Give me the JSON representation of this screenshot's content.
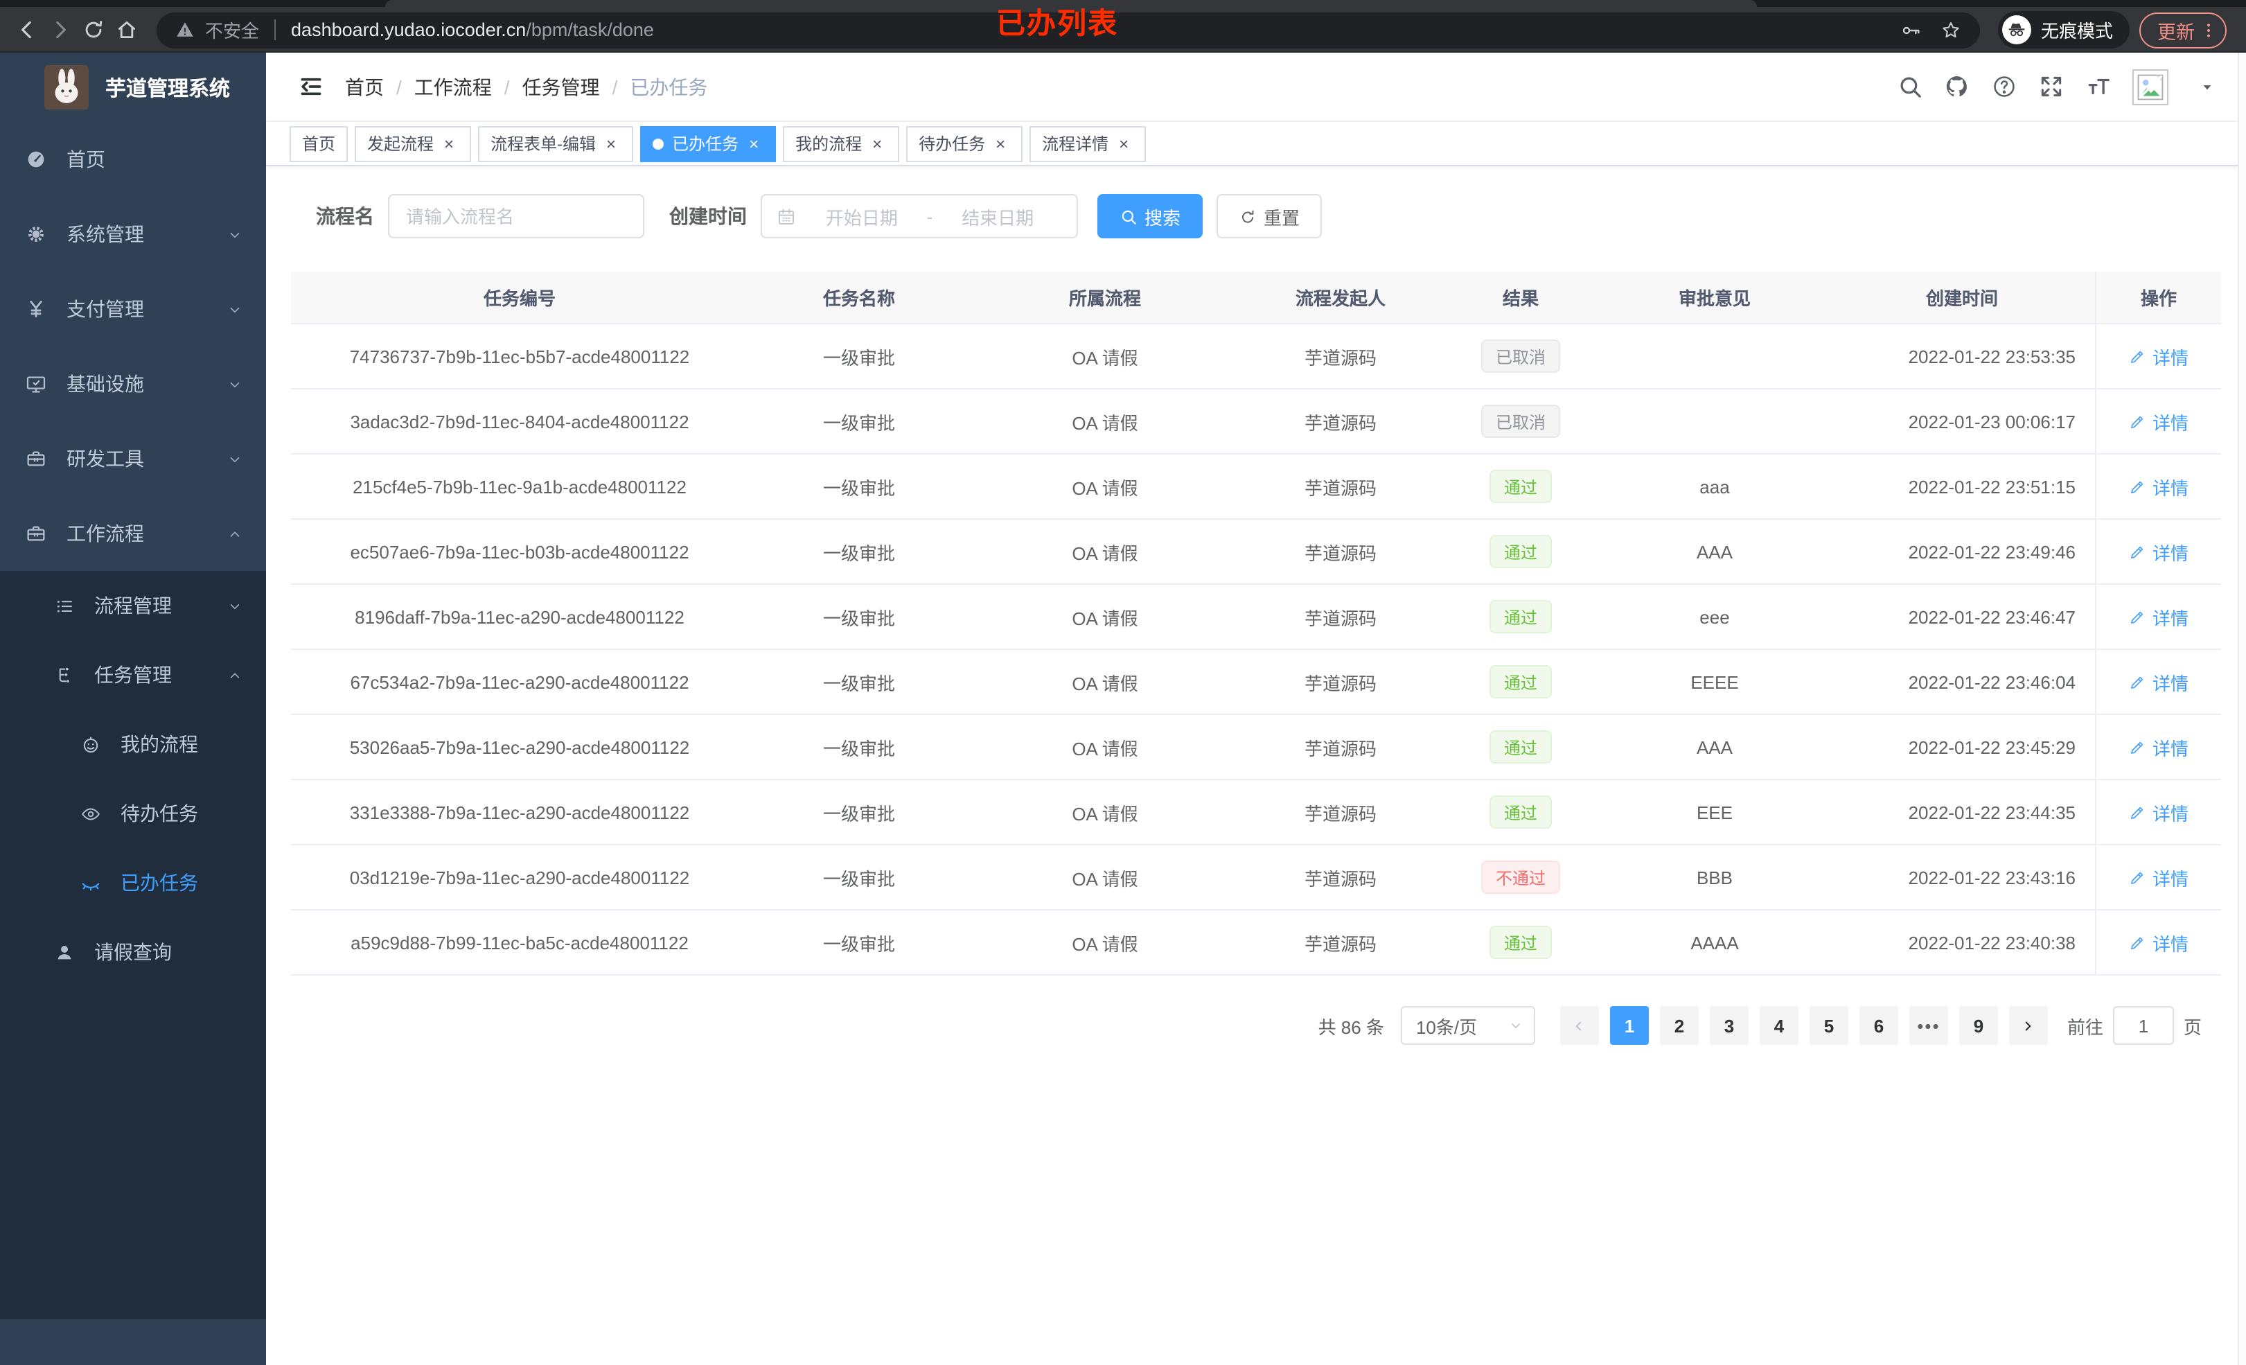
{
  "browser": {
    "security_label": "不安全",
    "url_host": "dashboard.yudao.iocoder.cn",
    "url_path": "/bpm/task/done",
    "incognito_label": "无痕模式",
    "update_label": "更新",
    "annotation": "已办列表"
  },
  "sidebar": {
    "title": "芋道管理系统",
    "menu": [
      {
        "icon": "dashboard",
        "label": "首页"
      },
      {
        "icon": "gear",
        "label": "系统管理",
        "arrow": "chevdown"
      },
      {
        "icon": "yen",
        "label": "支付管理",
        "arrow": "chevdown"
      },
      {
        "icon": "monitor",
        "label": "基础设施",
        "arrow": "chevdown"
      },
      {
        "icon": "toolbox",
        "label": "研发工具",
        "arrow": "chevdown"
      },
      {
        "icon": "toolbox",
        "label": "工作流程",
        "arrow": "chevup"
      }
    ],
    "submenu": [
      {
        "icon": "list",
        "label": "流程管理",
        "arrow": "chevdown",
        "lvl": "lvl1"
      },
      {
        "icon": "tree",
        "label": "任务管理",
        "arrow": "chevup",
        "lvl": "lvl1"
      },
      {
        "icon": "robot",
        "label": "我的流程",
        "lvl": "lvl2"
      },
      {
        "icon": "eye",
        "label": "待办任务",
        "lvl": "lvl2"
      },
      {
        "icon": "eyeclosed",
        "label": "已办任务",
        "lvl": "lvl2",
        "state": "active"
      },
      {
        "icon": "user",
        "label": "请假查询",
        "lvl": "lvl1"
      }
    ]
  },
  "header": {
    "breadcrumb": [
      {
        "label": "首页"
      },
      {
        "sep": "/",
        "label": "工作流程"
      },
      {
        "sep": "/",
        "label": "任务管理"
      },
      {
        "sep": "/",
        "label": "已办任务",
        "cls": "muted"
      }
    ]
  },
  "tabs": [
    {
      "label": "首页"
    },
    {
      "label": "发起流程",
      "close": "×"
    },
    {
      "label": "流程表单-编辑",
      "close": "×"
    },
    {
      "label": "已办任务",
      "close": "×",
      "cls": "active"
    },
    {
      "label": "我的流程",
      "close": "×"
    },
    {
      "label": "待办任务",
      "close": "×"
    },
    {
      "label": "流程详情",
      "close": "×"
    }
  ],
  "filters": {
    "name_label": "流程名",
    "name_placeholder": "请输入流程名",
    "time_label": "创建时间",
    "start_placeholder": "开始日期",
    "range_separator": "-",
    "end_placeholder": "结束日期",
    "search_label": "搜索",
    "reset_label": "重置"
  },
  "table": {
    "columns": [
      "任务编号",
      "任务名称",
      "所属流程",
      "流程发起人",
      "结果",
      "审批意见",
      "创建时间",
      "操作"
    ],
    "rows": [
      {
        "id": "74736737-7b9b-11ec-b5b7-acde48001122",
        "name": "一级审批",
        "process": "OA 请假",
        "initiator": "芋道源码",
        "result": "已取消",
        "result_type": "info",
        "comment": "",
        "created": "2022-01-22 23:53:35",
        "action": "详情"
      },
      {
        "id": "3adac3d2-7b9d-11ec-8404-acde48001122",
        "name": "一级审批",
        "process": "OA 请假",
        "initiator": "芋道源码",
        "result": "已取消",
        "result_type": "info",
        "comment": "",
        "created": "2022-01-23 00:06:17",
        "action": "详情"
      },
      {
        "id": "215cf4e5-7b9b-11ec-9a1b-acde48001122",
        "name": "一级审批",
        "process": "OA 请假",
        "initiator": "芋道源码",
        "result": "通过",
        "result_type": "success",
        "comment": "aaa",
        "created": "2022-01-22 23:51:15",
        "action": "详情"
      },
      {
        "id": "ec507ae6-7b9a-11ec-b03b-acde48001122",
        "name": "一级审批",
        "process": "OA 请假",
        "initiator": "芋道源码",
        "result": "通过",
        "result_type": "success",
        "comment": "AAA",
        "created": "2022-01-22 23:49:46",
        "action": "详情"
      },
      {
        "id": "8196daff-7b9a-11ec-a290-acde48001122",
        "name": "一级审批",
        "process": "OA 请假",
        "initiator": "芋道源码",
        "result": "通过",
        "result_type": "success",
        "comment": "eee",
        "created": "2022-01-22 23:46:47",
        "action": "详情"
      },
      {
        "id": "67c534a2-7b9a-11ec-a290-acde48001122",
        "name": "一级审批",
        "process": "OA 请假",
        "initiator": "芋道源码",
        "result": "通过",
        "result_type": "success",
        "comment": "EEEE",
        "created": "2022-01-22 23:46:04",
        "action": "详情"
      },
      {
        "id": "53026aa5-7b9a-11ec-a290-acde48001122",
        "name": "一级审批",
        "process": "OA 请假",
        "initiator": "芋道源码",
        "result": "通过",
        "result_type": "success",
        "comment": "AAA",
        "created": "2022-01-22 23:45:29",
        "action": "详情"
      },
      {
        "id": "331e3388-7b9a-11ec-a290-acde48001122",
        "name": "一级审批",
        "process": "OA 请假",
        "initiator": "芋道源码",
        "result": "通过",
        "result_type": "success",
        "comment": "EEE",
        "created": "2022-01-22 23:44:35",
        "action": "详情"
      },
      {
        "id": "03d1219e-7b9a-11ec-a290-acde48001122",
        "name": "一级审批",
        "process": "OA 请假",
        "initiator": "芋道源码",
        "result": "不通过",
        "result_type": "danger",
        "comment": "BBB",
        "created": "2022-01-22 23:43:16",
        "action": "详情"
      },
      {
        "id": "a59c9d88-7b99-11ec-ba5c-acde48001122",
        "name": "一级审批",
        "process": "OA 请假",
        "initiator": "芋道源码",
        "result": "通过",
        "result_type": "success",
        "comment": "AAAA",
        "created": "2022-01-22 23:40:38",
        "action": "详情"
      }
    ]
  },
  "pagination": {
    "total": "共 86 条",
    "page_size": "10条/页",
    "pages": [
      {
        "t": "1",
        "cls": "active"
      },
      {
        "t": "2"
      },
      {
        "t": "3"
      },
      {
        "t": "4"
      },
      {
        "t": "5"
      },
      {
        "t": "6"
      },
      {
        "t": "•••",
        "cls": "more"
      },
      {
        "t": "9"
      }
    ],
    "goto_label": "前往",
    "goto_value": "1",
    "unit_label": "页"
  }
}
